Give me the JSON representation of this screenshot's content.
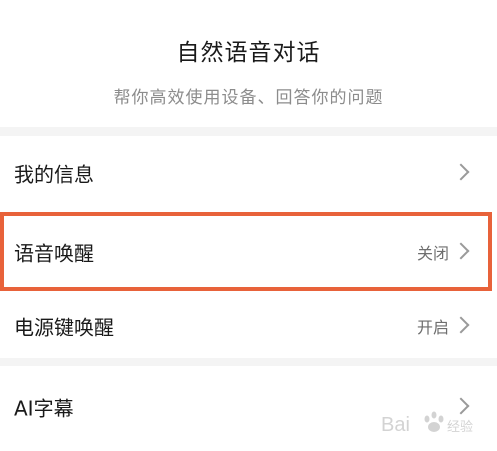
{
  "header": {
    "title": "自然语音对话",
    "subtitle": "帮你高效使用设备、回答你的问题"
  },
  "settings": {
    "my_info": {
      "label": "我的信息"
    },
    "voice_wake": {
      "label": "语音唤醒",
      "value": "关闭"
    },
    "power_key_wake": {
      "label": "电源键唤醒",
      "value": "开启"
    },
    "ai_subtitles": {
      "label": "AI字幕"
    }
  },
  "colors": {
    "highlight": "#e8623a",
    "background": "#f4f4f4",
    "card": "#ffffff"
  },
  "watermark": {
    "text": "Bai 经验"
  }
}
